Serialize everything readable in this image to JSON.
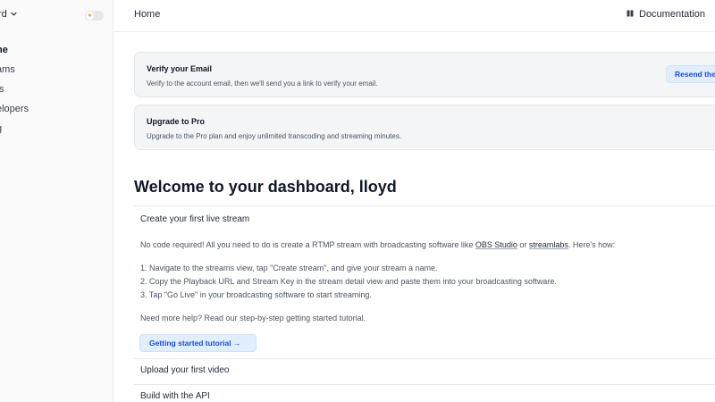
{
  "sidebar": {
    "project_label": "rd",
    "items": [
      {
        "label": "ne",
        "active": true
      },
      {
        "label": "ams",
        "active": false
      },
      {
        "label": "ts",
        "active": false
      },
      {
        "label": "elopers",
        "active": false
      },
      {
        "label": "g",
        "active": false
      }
    ]
  },
  "header": {
    "breadcrumb": "Home",
    "documentation_label": "Documentation"
  },
  "notices": {
    "verify": {
      "title": "Verify your Email",
      "text": "Verify to the account email, then we'll send you a link to verify your email.",
      "button_label": "Resend the"
    },
    "upgrade": {
      "title": "Upgrade to Pro",
      "text": "Upgrade to the Pro plan and enjoy unlimited transcoding and streaming minutes."
    }
  },
  "welcome_title": "Welcome to your dashboard, lloyd",
  "accordion": {
    "live_stream": {
      "title": "Create your first live stream",
      "intro_prefix": "No code required! All you need to do is create a RTMP stream with broadcasting software like ",
      "obs_link": "OBS Studio",
      "or_text": " or ",
      "streamlabs_link": "streamlabs",
      "intro_suffix": ". Here's how:",
      "steps": [
        "1. Navigate to the streams view, tap \"Create stream\", and give your stream a name.",
        "2. Copy the Playback URL and Stream Key in the stream detail view and paste them into your broadcasting software.",
        "3. Tap \"Go Live\" in your broadcasting software to start streaming."
      ],
      "help_text": "Need more help? Read our step-by-step getting started tutorial.",
      "tutorial_button": "Getting started tutorial →"
    },
    "upload_title": "Upload your first video",
    "api_title": "Build with the API"
  },
  "colors": {
    "accent": "#1d4ed8",
    "button_bg": "#e0eefe",
    "notice_bg": "#f4f5f7",
    "toggle_sun": "#f59e0b"
  },
  "icons": {
    "sidebar_chevron": "chevron-down-icon",
    "theme_toggle": "sun-icon",
    "documentation": "book-icon"
  }
}
